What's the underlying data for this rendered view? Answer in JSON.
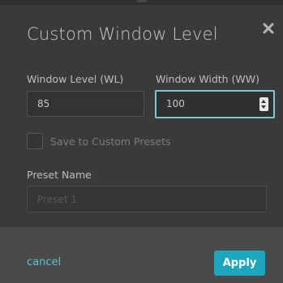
{
  "dialog": {
    "title": "Custom Window Level",
    "close_icon": "close-icon"
  },
  "fields": {
    "window_level": {
      "label": "Window Level (WL)",
      "value": "85"
    },
    "window_width": {
      "label": "Window Width (WW)",
      "value": "100"
    },
    "save_preset": {
      "label": "Save to Custom Presets",
      "checked": false
    },
    "preset_name": {
      "label": "Preset Name",
      "placeholder": "Preset 1"
    }
  },
  "footer": {
    "cancel_label": "cancel",
    "apply_label": "Apply"
  },
  "colors": {
    "accent": "#1ba7bd",
    "link": "#59c2d4",
    "focus_border": "#7ec9d6",
    "background": "#3a3a3a",
    "footer": "#4a4a4a"
  }
}
